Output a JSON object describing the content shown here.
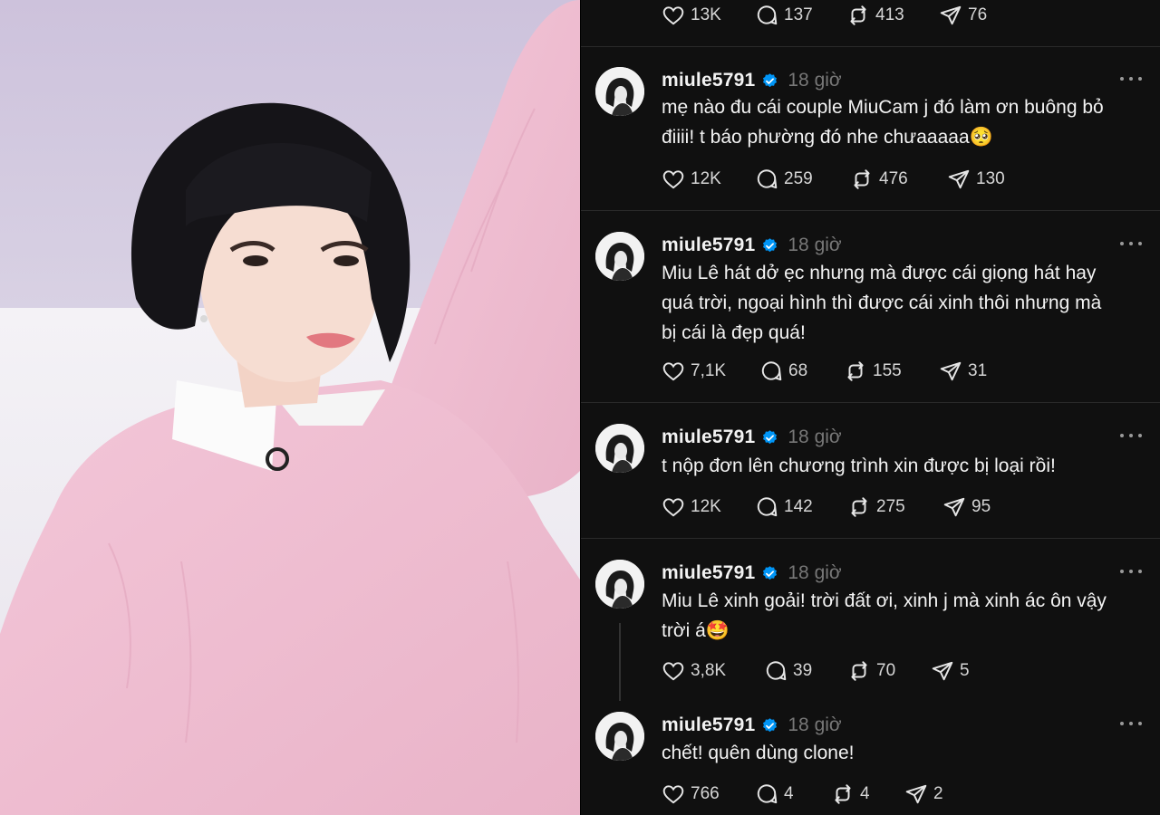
{
  "photo": {
    "description_icon": "person-photo"
  },
  "top_actions": {
    "likes": "13K",
    "replies": "137",
    "reposts": "413",
    "shares": "76"
  },
  "posts": [
    {
      "username": "miule5791",
      "time": "18 giờ",
      "text_lines": [
        "mẹ nào đu cái couple MiuCam j đó làm ơn buông bỏ",
        "điiii! t báo phường đó nhe chưaaaaa🥺"
      ],
      "likes": "12K",
      "replies": "259",
      "reposts": "476",
      "shares": "130"
    },
    {
      "username": "miule5791",
      "time": "18 giờ",
      "text_lines": [
        "Miu Lê hát dở ẹc nhưng mà được cái giọng hát hay",
        "quá trời, ngoại hình thì được cái xinh thôi nhưng mà",
        "bị cái là đẹp quá!"
      ],
      "likes": "7,1K",
      "replies": "68",
      "reposts": "155",
      "shares": "31"
    },
    {
      "username": "miule5791",
      "time": "18 giờ",
      "text_lines": [
        "t nộp đơn lên chương trình xin được bị loại rồi!"
      ],
      "likes": "12K",
      "replies": "142",
      "reposts": "275",
      "shares": "95"
    },
    {
      "username": "miule5791",
      "time": "18 giờ",
      "text_lines": [
        "Miu Lê xinh goải! trời đất ơi, xinh j mà xinh ác ôn vậy",
        "trời á🤩"
      ],
      "likes": "3,8K",
      "replies": "39",
      "reposts": "70",
      "shares": "5"
    },
    {
      "username": "miule5791",
      "time": "18 giờ",
      "text_lines": [
        "chết! quên dùng clone!"
      ],
      "likes": "766",
      "replies": "4",
      "reposts": "4",
      "shares": "2"
    }
  ],
  "colors": {
    "feed_bg": "#101010",
    "verified": "#0095f6",
    "muted": "#777777"
  }
}
